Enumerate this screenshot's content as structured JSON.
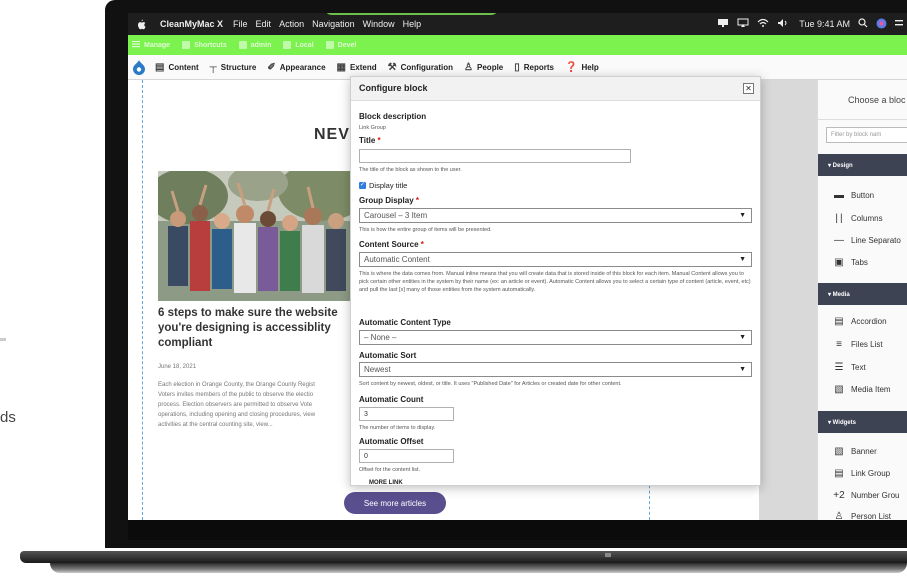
{
  "background": {
    "side_text": "ds"
  },
  "mac_menu_bar": {
    "app_name": "CleanMyMac X",
    "menus": [
      "File",
      "Edit",
      "Action",
      "Navigation",
      "Window",
      "Help"
    ],
    "clock": "Tue 9:41 AM"
  },
  "admin_toolbar": {
    "items": [
      "Manage",
      "Shortcuts",
      "admin",
      "Local",
      "Devel"
    ]
  },
  "admin_tray": {
    "items": [
      "Content",
      "Structure",
      "Appearance",
      "Extend",
      "Configuration",
      "People",
      "Reports",
      "Help"
    ]
  },
  "page": {
    "heading": "NEV",
    "article": {
      "title": "6 steps to make sure the website you're designing is accessiblity compliant",
      "date": "June 18, 2021",
      "body_lines": [
        "Each election in Orange County, the Orange County Regist",
        "Voters invites members of the public to observe the electio",
        "process. Election observers are permitted to observe Vote",
        "operations, including opening and closing procedures, view",
        "activities at the central counting site, view..."
      ]
    },
    "more_button": "See more articles"
  },
  "block_sidebar": {
    "title": "Choose a bloc",
    "filter_placeholder": "Filter by block nam",
    "sections": {
      "design": "▾ Design",
      "media": "▾ Media",
      "widgets": "▾ Widgets"
    },
    "design_items": [
      "Button",
      "Columns",
      "Line Separato",
      "Tabs"
    ],
    "media_items": [
      "Accordion",
      "Files List",
      "Text",
      "Media Item"
    ],
    "widget_items": [
      "Banner",
      "Link Group",
      "Number Grou",
      "Person List"
    ]
  },
  "modal": {
    "title": "Configure block",
    "close_label": "✕",
    "block_description_label": "Block description",
    "block_description_value": "Link Group",
    "title_label": "Title",
    "required_marker": "*",
    "title_value": "",
    "title_help": "The title of the block as shown to the user.",
    "display_title_label": "Display title",
    "group_display_label": "Group Display",
    "group_display_value": "Carousel – 3 Item",
    "group_display_help": "This is how the entire group of items will be presented.",
    "content_source_label": "Content Source",
    "content_source_value": "Automatic Content",
    "content_source_help": "This is where the data comes from. Manual inline means that you will create data that is stored inside of this block for each item. Manual Content allows you to pick certain other entities in the system by their name (ex: an article or event). Automatic Content allows you to select a certain type of content (article, event, etc) and pull the last [x] many of those entities from the system automatically.",
    "content_type_label": "Automatic Content Type",
    "content_type_value": "– None –",
    "sort_label": "Automatic Sort",
    "sort_value": "Newest",
    "sort_help": "Sort content by newest, oldest, or title. It uses \"Published Date\" for Articles or created date for other content.",
    "count_label": "Automatic Count",
    "count_value": "3",
    "count_help": "The number of items to display.",
    "offset_label": "Automatic Offset",
    "offset_value": "0",
    "offset_help": "Offset for the content list.",
    "more_link_cut": "MORE LINK"
  }
}
